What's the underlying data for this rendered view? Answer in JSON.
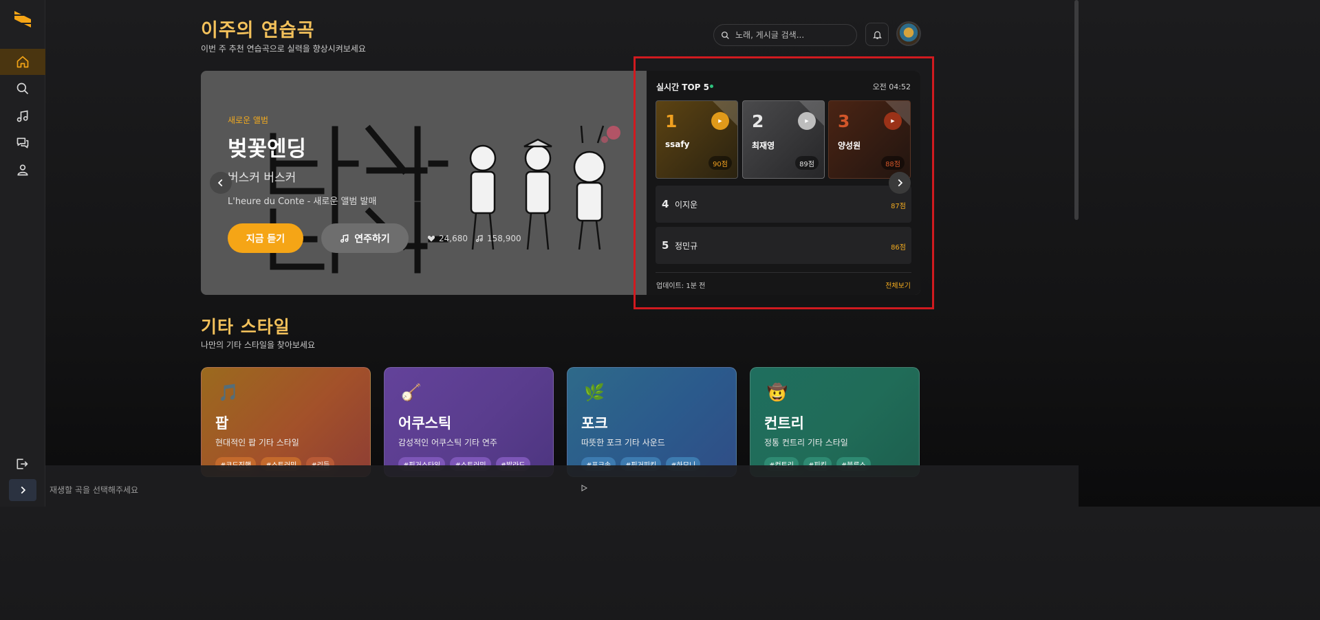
{
  "sidebar": {
    "items": [
      {
        "icon": "home-icon",
        "active": true
      },
      {
        "icon": "search-icon",
        "active": false
      },
      {
        "icon": "music-note-icon",
        "active": false
      },
      {
        "icon": "chat-icon",
        "active": false
      },
      {
        "icon": "user-icon",
        "active": false
      }
    ],
    "logout_icon": "logout-icon",
    "expand_icon": "chevron-right-icon"
  },
  "header": {
    "title": "이주의 연습곡",
    "subtitle": "이번 주 추천 연습곡으로 실력을 향상시켜보세요",
    "search_placeholder": "노래, 게시글 검색..."
  },
  "hero": {
    "tag": "새로운 앨범",
    "title": "벚꽃엔딩",
    "artist": "버스커 버스커",
    "description": "L'heure du Conte - 새로운 앨범 발매",
    "listen_label": "지금 듣기",
    "play_label": "연주하기",
    "likes": "24,680",
    "plays": "158,900"
  },
  "top5": {
    "title": "실시간 TOP 5",
    "time": "오전 04:52",
    "podium": [
      {
        "rank": "1",
        "name": "ssafy",
        "score": "90점",
        "color": "#f0a020"
      },
      {
        "rank": "2",
        "name": "최재영",
        "score": "89점",
        "color": "#e0e0e0"
      },
      {
        "rank": "3",
        "name": "양성원",
        "score": "88점",
        "color": "#d2562a"
      }
    ],
    "list": [
      {
        "rank": "4",
        "name": "이지운",
        "score": "87점"
      },
      {
        "rank": "5",
        "name": "정민규",
        "score": "86점"
      }
    ],
    "updated": "업데이트: 1분 전",
    "view_all": "전체보기"
  },
  "styles": {
    "title": "기타 스타일",
    "subtitle": "나만의 기타 스타일을 찾아보세요",
    "cards": [
      {
        "name": "팝",
        "desc": "현대적인 팝 기타 스타일",
        "icon": "music-notes-icon",
        "glyph": "🎵",
        "tags": [
          "#코드진행",
          "#스트러밍",
          "#리듬"
        ]
      },
      {
        "name": "어쿠스틱",
        "desc": "감성적인 어쿠스틱 기타 연주",
        "icon": "banjo-icon",
        "glyph": "🪕",
        "tags": [
          "#핑거스타일",
          "#스트러밍",
          "#발라드"
        ]
      },
      {
        "name": "포크",
        "desc": "따뜻한 포크 기타 사운드",
        "icon": "herb-icon",
        "glyph": "🌿",
        "tags": [
          "#포크송",
          "#핑거피킹",
          "#하모니"
        ]
      },
      {
        "name": "컨트리",
        "desc": "정통 컨트리 기타 스타일",
        "icon": "cowboy-face-icon",
        "glyph": "🤠",
        "tags": [
          "#컨트리",
          "#피킹",
          "#블루스"
        ]
      }
    ]
  },
  "player": {
    "placeholder": "재생할 곡을 선택해주세요"
  },
  "colors": {
    "accent": "#f5a516",
    "title": "#f3c15b",
    "highlight": "#d11a1f"
  }
}
